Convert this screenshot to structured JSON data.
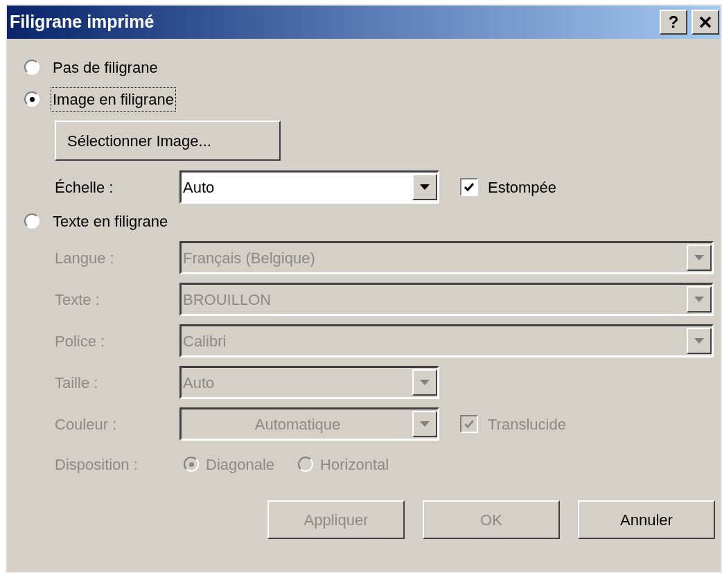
{
  "window": {
    "title": "Filigrane imprimé",
    "help_button": "?"
  },
  "modes": [
    {
      "label": "Pas de filigrane",
      "selected": false,
      "focused": false
    },
    {
      "label": "Image en filigrane",
      "selected": true,
      "focused": true
    },
    {
      "label": "Texte en filigrane",
      "selected": false,
      "focused": false
    }
  ],
  "image_options": {
    "select_button": "Sélectionner Image...",
    "scale_label": "Échelle :",
    "scale_value": "Auto",
    "washout": {
      "label": "Estompée",
      "checked": true
    }
  },
  "text_options": {
    "disabled": true,
    "fields": [
      {
        "label": "Langue :",
        "value": "Français (Belgique)",
        "kind": "wide"
      },
      {
        "label": "Texte :",
        "value": "BROUILLON",
        "kind": "wide"
      },
      {
        "label": "Police :",
        "value": "Calibri",
        "kind": "wide"
      },
      {
        "label": "Taille :",
        "value": "Auto",
        "kind": "narrow"
      },
      {
        "label": "Couleur :",
        "value": "Automatique",
        "kind": "color"
      }
    ],
    "translucent": {
      "label": "Translucide",
      "checked": true
    },
    "layout_label": "Disposition :",
    "layouts": [
      {
        "label": "Diagonale",
        "selected": true
      },
      {
        "label": "Horizontal",
        "selected": false
      }
    ]
  },
  "buttons": [
    {
      "label": "Appliquer",
      "disabled": true
    },
    {
      "label": "OK",
      "disabled": true
    },
    {
      "label": "Annuler",
      "disabled": false
    }
  ]
}
